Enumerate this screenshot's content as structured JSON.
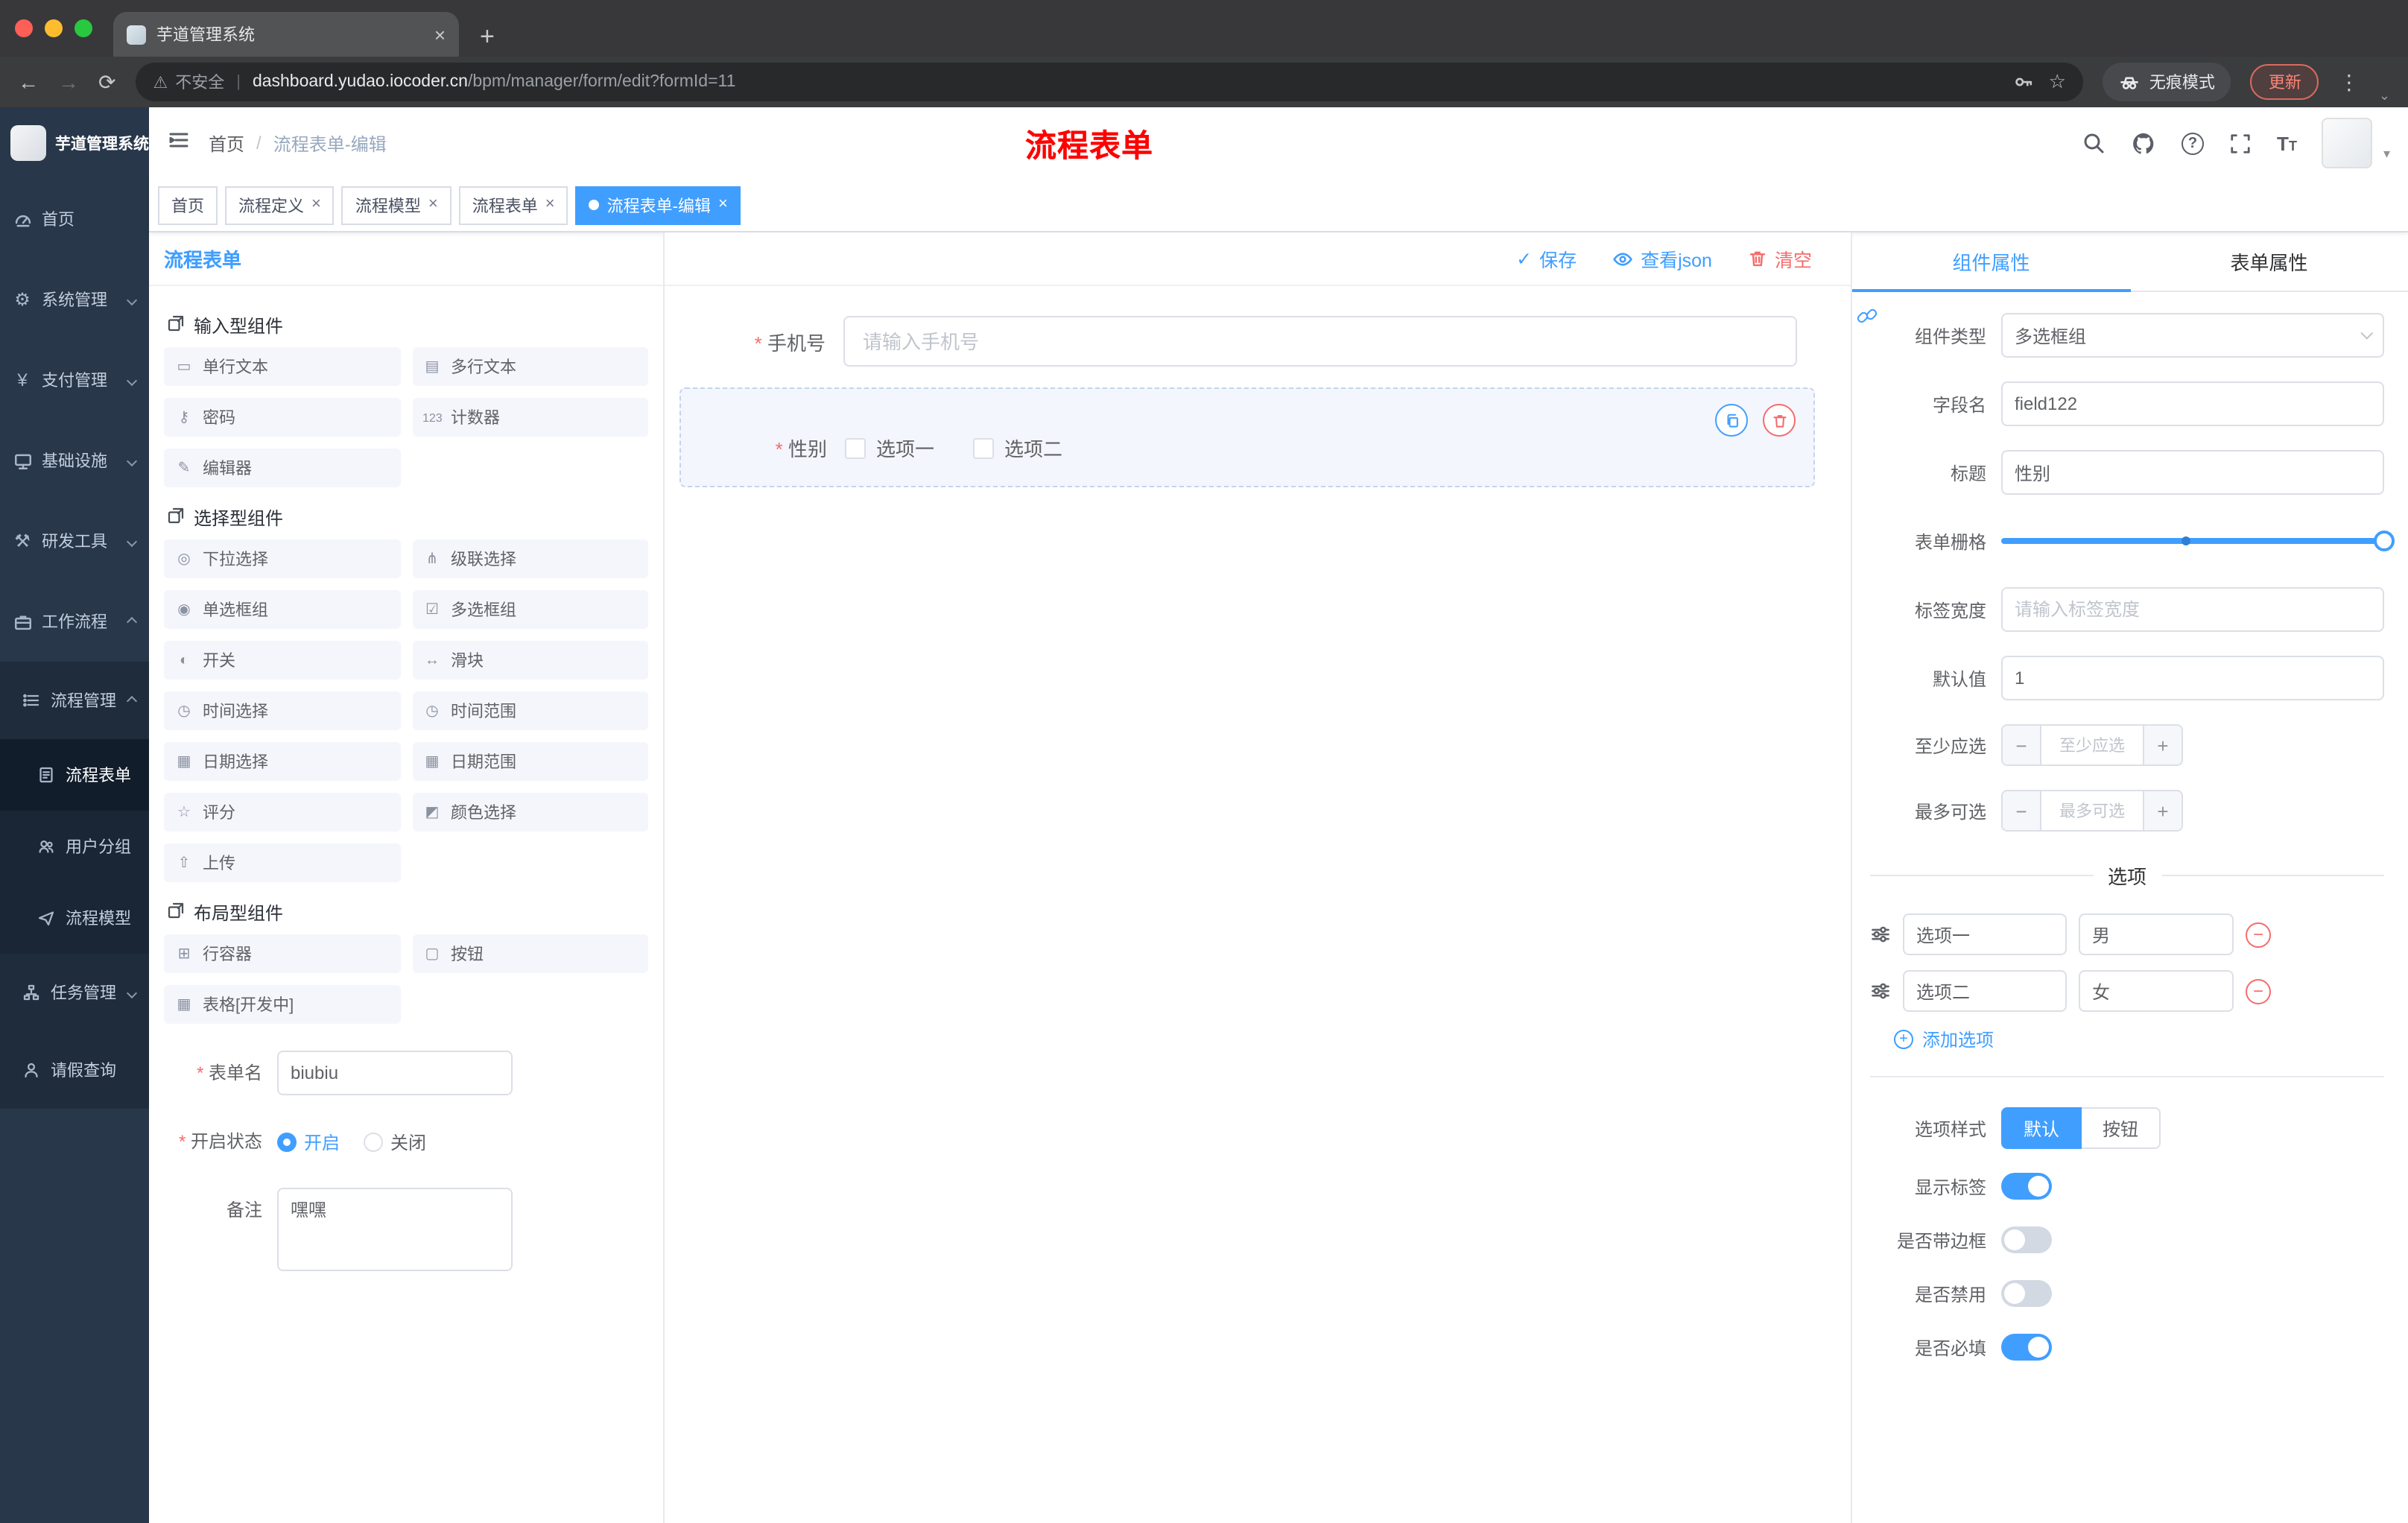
{
  "browser": {
    "tab_title": "芋道管理系统",
    "security_label": "不安全",
    "url_domain": "dashboard.yudao.iocoder.cn",
    "url_path": "/bpm/manager/form/edit?formId=11",
    "incognito_label": "无痕模式",
    "update_label": "更新"
  },
  "sidebar": {
    "logo_title": "芋道管理系统",
    "menu": [
      {
        "label": "首页"
      },
      {
        "label": "系统管理"
      },
      {
        "label": "支付管理"
      },
      {
        "label": "基础设施"
      },
      {
        "label": "研发工具"
      },
      {
        "label": "工作流程",
        "children": [
          {
            "label": "流程管理",
            "children": [
              {
                "label": "流程表单",
                "active": true
              },
              {
                "label": "用户分组"
              },
              {
                "label": "流程模型"
              }
            ]
          },
          {
            "label": "任务管理"
          },
          {
            "label": "请假查询"
          }
        ]
      }
    ]
  },
  "header": {
    "breadcrumb": [
      "首页",
      "流程表单-编辑"
    ],
    "separator": "/",
    "annotation": "流程表单"
  },
  "tags": [
    {
      "label": "首页"
    },
    {
      "label": "流程定义"
    },
    {
      "label": "流程模型"
    },
    {
      "label": "流程表单"
    },
    {
      "label": "流程表单-编辑",
      "active": true
    }
  ],
  "palette": {
    "title": "流程表单",
    "groups": [
      {
        "title": "输入型组件",
        "items": [
          {
            "icon": "▭",
            "label": "单行文本"
          },
          {
            "icon": "▤",
            "label": "多行文本"
          },
          {
            "icon": "⚷",
            "label": "密码"
          },
          {
            "icon": "123",
            "label": "计数器"
          },
          {
            "icon": "✎",
            "label": "编辑器"
          }
        ]
      },
      {
        "title": "选择型组件",
        "items": [
          {
            "icon": "◎",
            "label": "下拉选择"
          },
          {
            "icon": "⋔",
            "label": "级联选择"
          },
          {
            "icon": "◉",
            "label": "单选框组"
          },
          {
            "icon": "☑",
            "label": "多选框组"
          },
          {
            "icon": "◐",
            "label": "开关"
          },
          {
            "icon": "↔",
            "label": "滑块"
          },
          {
            "icon": "◷",
            "label": "时间选择"
          },
          {
            "icon": "◷",
            "label": "时间范围"
          },
          {
            "icon": "▦",
            "label": "日期选择"
          },
          {
            "icon": "▦",
            "label": "日期范围"
          },
          {
            "icon": "☆",
            "label": "评分"
          },
          {
            "icon": "◩",
            "label": "颜色选择"
          },
          {
            "icon": "⇧",
            "label": "上传"
          }
        ]
      },
      {
        "title": "布局型组件",
        "items": [
          {
            "icon": "⊞",
            "label": "行容器"
          },
          {
            "icon": "▢",
            "label": "按钮"
          },
          {
            "icon": "▦",
            "label": "表格[开发中]"
          }
        ]
      }
    ],
    "form": {
      "name_label": "表单名",
      "name_value": "biubiu",
      "status_label": "开启状态",
      "status_on": "开启",
      "status_off": "关闭",
      "status_value": "开启",
      "remark_label": "备注",
      "remark_value": "嘿嘿"
    }
  },
  "canvas": {
    "toolbar": {
      "save": "保存",
      "view_json": "查看json",
      "clear": "清空"
    },
    "phone": {
      "label": "手机号",
      "placeholder": "请输入手机号"
    },
    "gender": {
      "label": "性别",
      "options": [
        "选项一",
        "选项二"
      ]
    }
  },
  "props": {
    "tabs": [
      "组件属性",
      "表单属性"
    ],
    "active_tab": "组件属性",
    "component_type": {
      "label": "组件类型",
      "value": "多选框组"
    },
    "field_name": {
      "label": "字段名",
      "value": "field122"
    },
    "title": {
      "label": "标题",
      "value": "性别"
    },
    "grid": {
      "label": "表单栅格"
    },
    "label_width": {
      "label": "标签宽度",
      "placeholder": "请输入标签宽度"
    },
    "default": {
      "label": "默认值",
      "value": "1"
    },
    "min": {
      "label": "至少应选",
      "placeholder": "至少应选"
    },
    "max": {
      "label": "最多可选",
      "placeholder": "最多可选"
    },
    "options_title": "选项",
    "options": [
      {
        "label": "选项一",
        "value": "男"
      },
      {
        "label": "选项二",
        "value": "女"
      }
    ],
    "add_option": "添加选项",
    "style": {
      "label": "选项样式",
      "options": [
        "默认",
        "按钮"
      ],
      "value": "默认"
    },
    "toggles": [
      {
        "label": "显示标签",
        "on": true
      },
      {
        "label": "是否带边框",
        "on": false
      },
      {
        "label": "是否禁用",
        "on": false
      },
      {
        "label": "是否必填",
        "on": true
      }
    ]
  },
  "colors": {
    "primary": "#409eff",
    "danger": "#f56c6c",
    "annotation": "#ff0000"
  }
}
